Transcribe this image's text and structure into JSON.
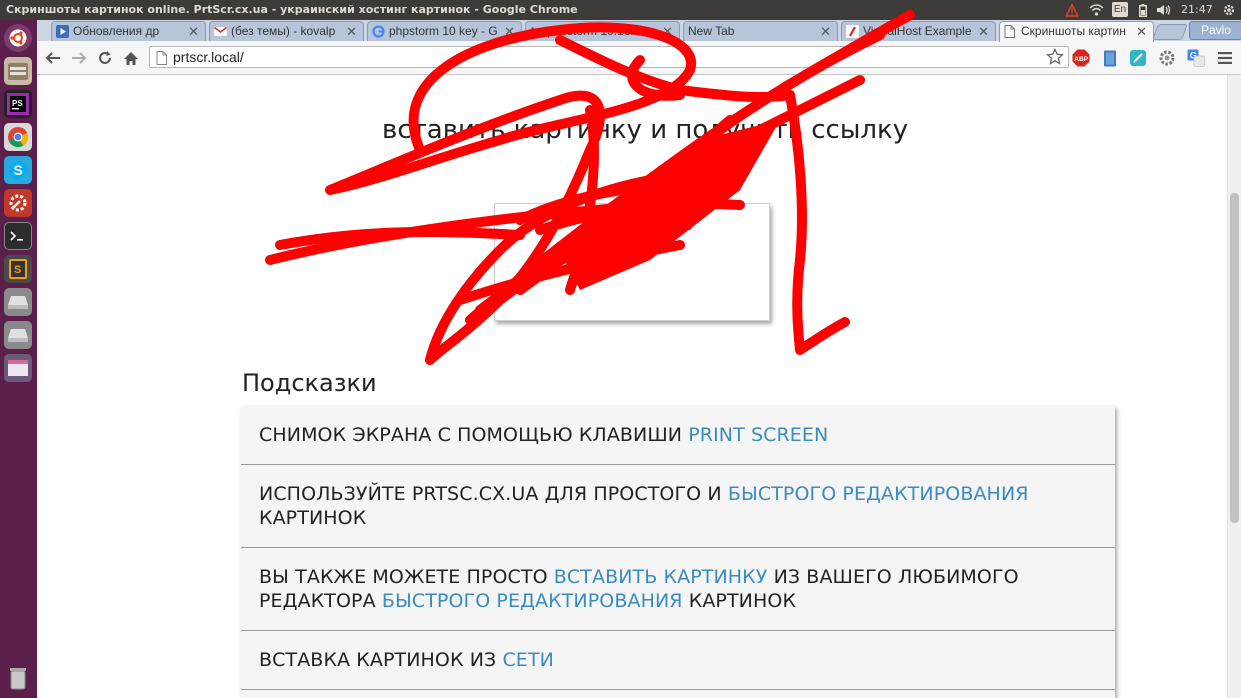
{
  "window": {
    "title": "Скриншоты картинок online. PrtScr.cx.ua - украинский хостинг картинок - Google Chrome"
  },
  "system_tray": {
    "keyboard_layout": "En",
    "clock": "21:47"
  },
  "tabs": [
    {
      "label": "Обновления др",
      "icon": "video-favicon",
      "active": false
    },
    {
      "label": "(без темы) - kovalp",
      "icon": "gmail-favicon",
      "active": false
    },
    {
      "label": "phpstorm 10 key - G",
      "icon": "google-favicon",
      "active": false
    },
    {
      "label": "phpstorm 10.16.1",
      "icon": "loading-favicon",
      "active": false
    },
    {
      "label": "New Tab",
      "icon": "",
      "active": false
    },
    {
      "label": "VirtualHost Example",
      "icon": "apache-favicon",
      "active": false
    },
    {
      "label": "Скриншоты картин",
      "icon": "page-favicon",
      "active": true
    }
  ],
  "profile": {
    "name": "Pavlo"
  },
  "address_bar": {
    "url": "prtscr.local/"
  },
  "page": {
    "headline": "вставить картинку и получить ссылку",
    "paste_box": {
      "prefix": "Нажм",
      "hotkey": "+V"
    },
    "tips_heading": "Подсказки",
    "tips": [
      {
        "text": "Снимок экрана с помощью клавиши ",
        "link": "Print Screen",
        "after": ""
      },
      {
        "text": "Используйте PrtSc.cx.ua для простого и ",
        "link": "быстрого редактирования",
        "after": " картинок"
      },
      {
        "text": "Вы также можете просто ",
        "link": "вставить картинку",
        "after": " из вашего любимого редактора ",
        "link2": "быстрого редактирования",
        "after2": " картинок"
      },
      {
        "text": "Вставка картинок из ",
        "link": "сети",
        "after": ""
      }
    ]
  },
  "colors": {
    "link": "#3a8cc0",
    "launcher_bg": "#5a1f4b",
    "panel_bg": "#3c3b37",
    "scribble": "#ff0000"
  }
}
